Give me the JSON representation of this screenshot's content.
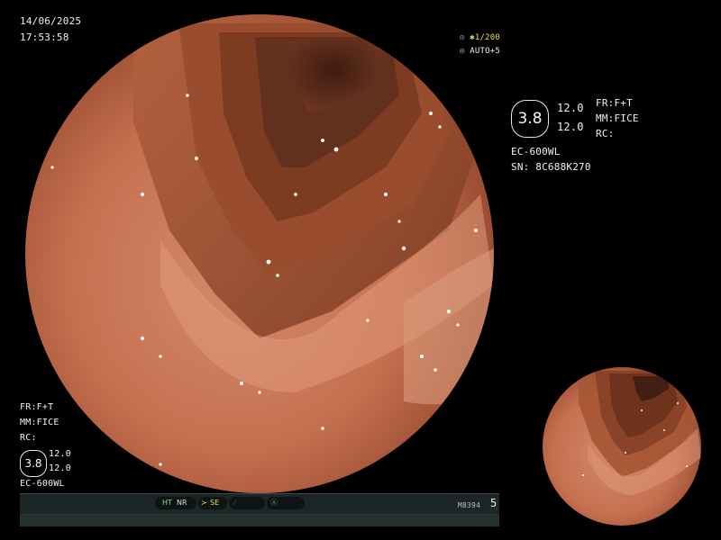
{
  "header": {
    "date": "14/06/2025",
    "time": "17:53:58"
  },
  "exposure": {
    "shutter": "1/200",
    "auto": "AUTO+5"
  },
  "right_panel": {
    "structure_level": "3.8",
    "value_1": "12.0",
    "value_2": "12.0",
    "fr": "FR:F+T",
    "mm": "MM:FICE",
    "rc": "RC:",
    "model": "EC-600WL",
    "serial": "SN: 8C688K270"
  },
  "left_panel": {
    "fr": "FR:F+T",
    "mm": "MM:FICE",
    "rc": "RC:",
    "structure_level": "3.8",
    "value_1": "12.0",
    "value_2": "12.0",
    "model": "EC-600WL"
  },
  "status_bar": {
    "ht": "HT",
    "nr": "NR",
    "se": "SE",
    "code": "M8394",
    "page": "5"
  },
  "colors": {
    "mucosa": "#c8765a",
    "lumen": "#5a2c1a",
    "accent_yellow": "#e0e040",
    "status_green": "#7fe07f"
  }
}
